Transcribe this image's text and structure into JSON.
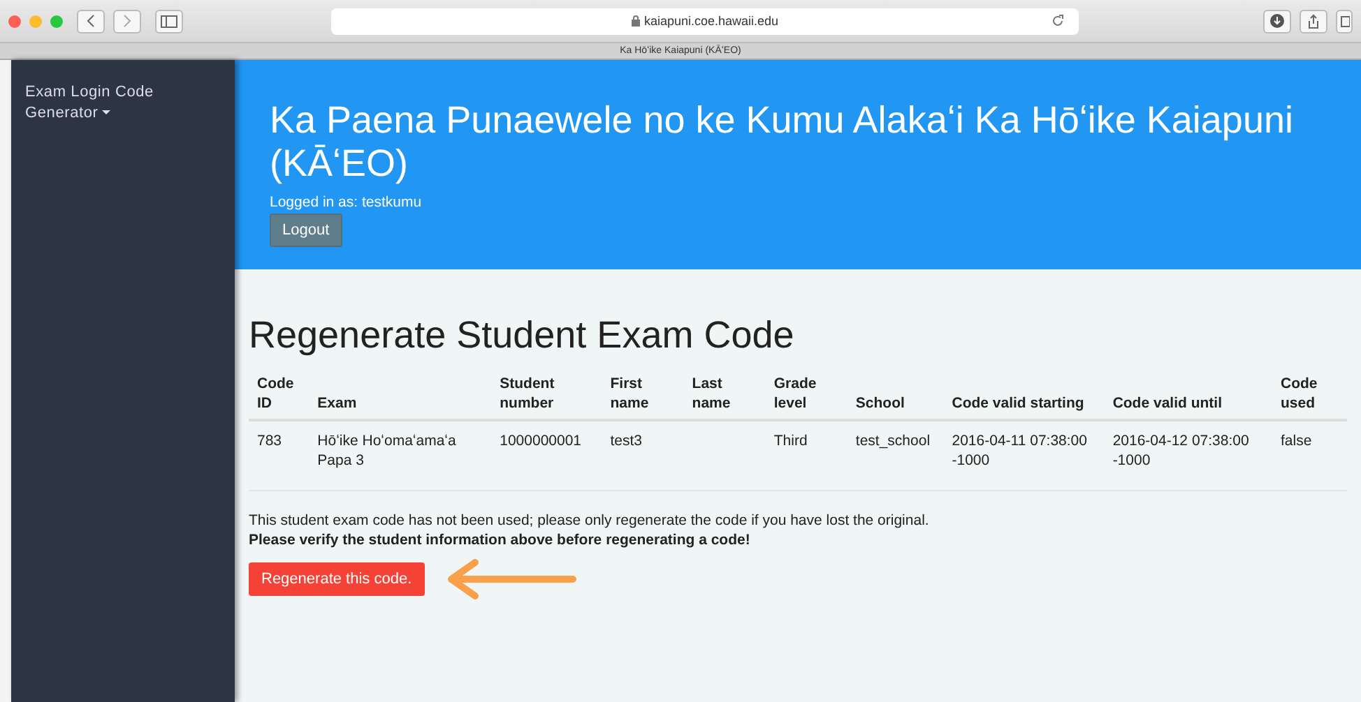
{
  "browser": {
    "address": "kaiapuni.coe.hawaii.edu",
    "tab_title": "Ka Hōʻike Kaiapuni (KĀʻEO)"
  },
  "sidebar": {
    "title": "Exam Login Code Generator"
  },
  "header": {
    "title": "Ka Paena Punaewele no ke Kumu Alakaʻi Ka Hōʻike Kaiapuni (KĀʻEO)",
    "logged_in": "Logged in as: testkumu",
    "logout": "Logout"
  },
  "heading": "Regenerate Student Exam Code",
  "table": {
    "columns": [
      "Code ID",
      "Exam",
      "Student number",
      "First name",
      "Last name",
      "Grade level",
      "School",
      "Code valid starting",
      "Code valid until",
      "Code used"
    ],
    "rows": [
      [
        "783",
        "Hōʻike Hoʻomaʻamaʻa Papa 3",
        "1000000001",
        "test3",
        "",
        "Third",
        "test_school",
        "2016-04-11 07:38:00 -1000",
        "2016-04-12 07:38:00 -1000",
        "false"
      ]
    ]
  },
  "notice": "This student exam code has not been used; please only regenerate the code if you have lost the original.",
  "warning": "Please verify the student information above before regenerating a code!",
  "regenerate_button": "Regenerate this code."
}
